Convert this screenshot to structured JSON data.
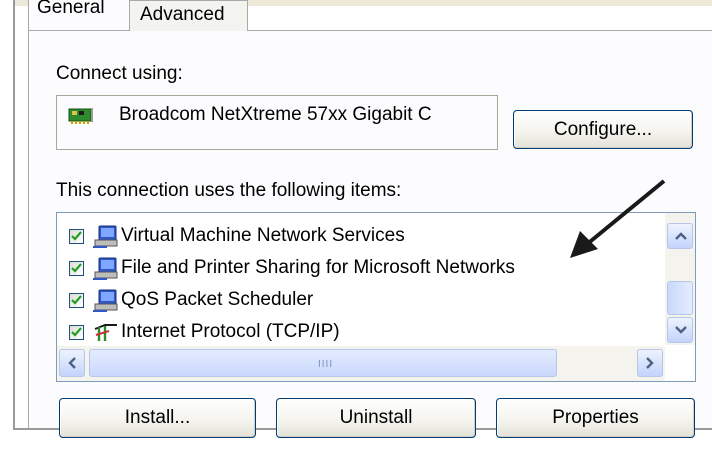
{
  "tabs": [
    {
      "label": "General",
      "active": true
    },
    {
      "label": "Advanced",
      "active": false
    }
  ],
  "connect_using": {
    "label": "Connect using:",
    "adapter": "Broadcom NetXtreme 57xx Gigabit C",
    "configure_label": "Configure..."
  },
  "items_section": {
    "label": "This connection uses the following items:",
    "items": [
      {
        "label": "Virtual Machine Network Services",
        "checked": true,
        "icon": "network-service-icon"
      },
      {
        "label": "File and Printer Sharing for Microsoft Networks",
        "checked": true,
        "icon": "network-service-icon"
      },
      {
        "label": "QoS Packet Scheduler",
        "checked": true,
        "icon": "network-service-icon"
      },
      {
        "label": "Internet Protocol (TCP/IP)",
        "checked": true,
        "icon": "protocol-icon"
      }
    ]
  },
  "buttons": {
    "install": "Install...",
    "uninstall": "Uninstall",
    "properties": "Properties"
  },
  "colors": {
    "dialog_bg": "#fcfcfe",
    "button_border": "#003c74",
    "list_border": "#7f9db9",
    "annotation": "#1a1a1a"
  }
}
